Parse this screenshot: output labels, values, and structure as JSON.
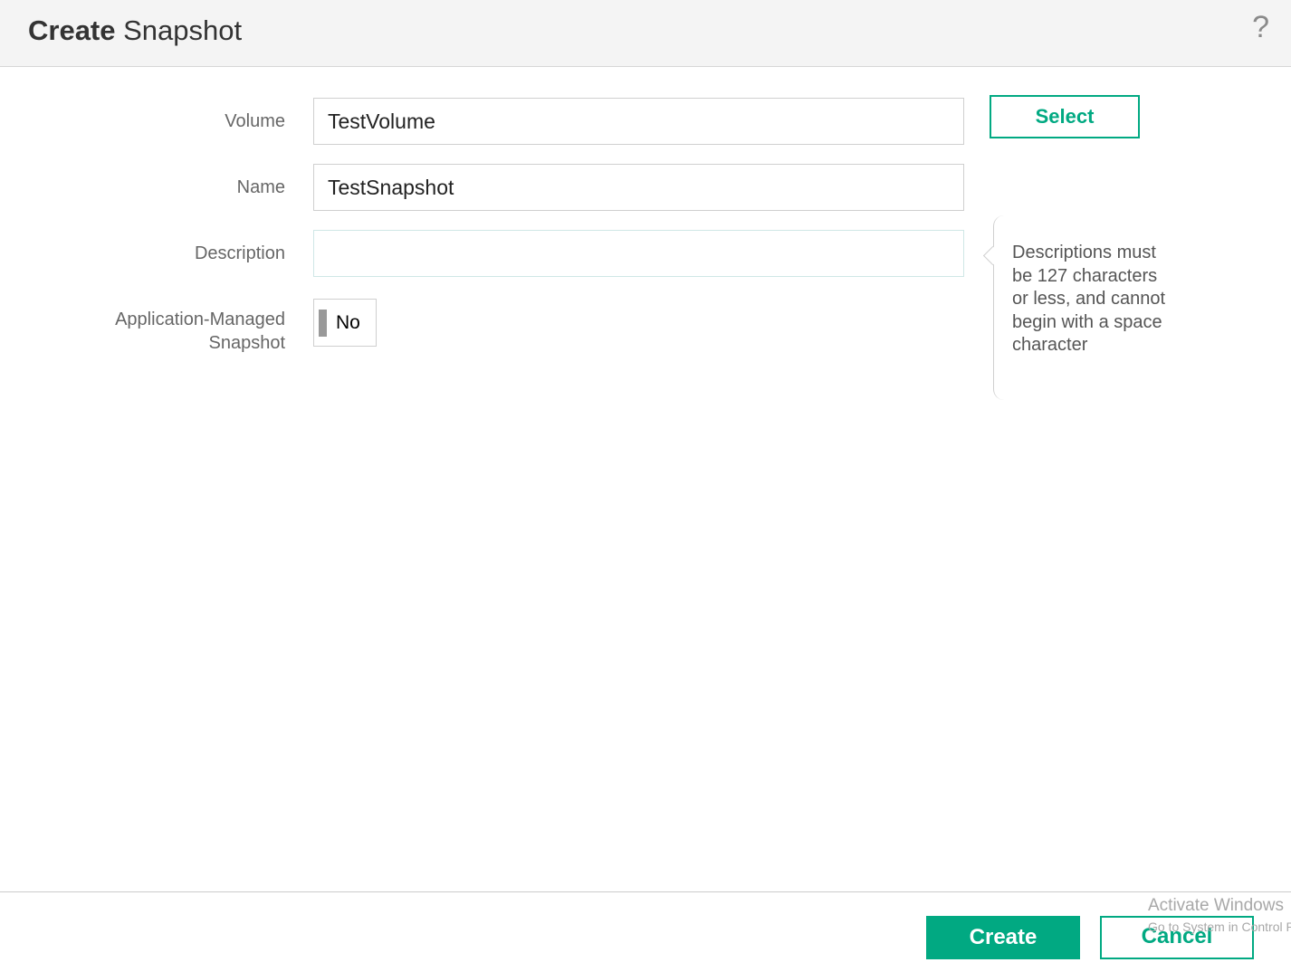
{
  "header": {
    "title_bold": "Create",
    "title_rest": " Snapshot",
    "help_glyph": "?"
  },
  "form": {
    "volume": {
      "label": "Volume",
      "value": "TestVolume",
      "select_label": "Select"
    },
    "name": {
      "label": "Name",
      "value": "TestSnapshot"
    },
    "description": {
      "label": "Description",
      "value": "",
      "hint": "Descriptions must be 127 characters or less, and cannot begin with a space character"
    },
    "app_managed": {
      "label_line1": "Application-Managed",
      "label_line2": "Snapshot",
      "value": "No"
    }
  },
  "footer": {
    "create_label": "Create",
    "cancel_label": "Cancel"
  },
  "watermark": {
    "line1": "Activate Windows",
    "line2": "Go to System in Control Panel to activate Windows."
  },
  "colors": {
    "accent": "#01a982",
    "header_bg": "#f4f4f4",
    "label_text": "#666666",
    "border": "#cfcfcf"
  },
  "icons": {
    "help": "help-icon",
    "toggle": "toggle-indicator"
  }
}
